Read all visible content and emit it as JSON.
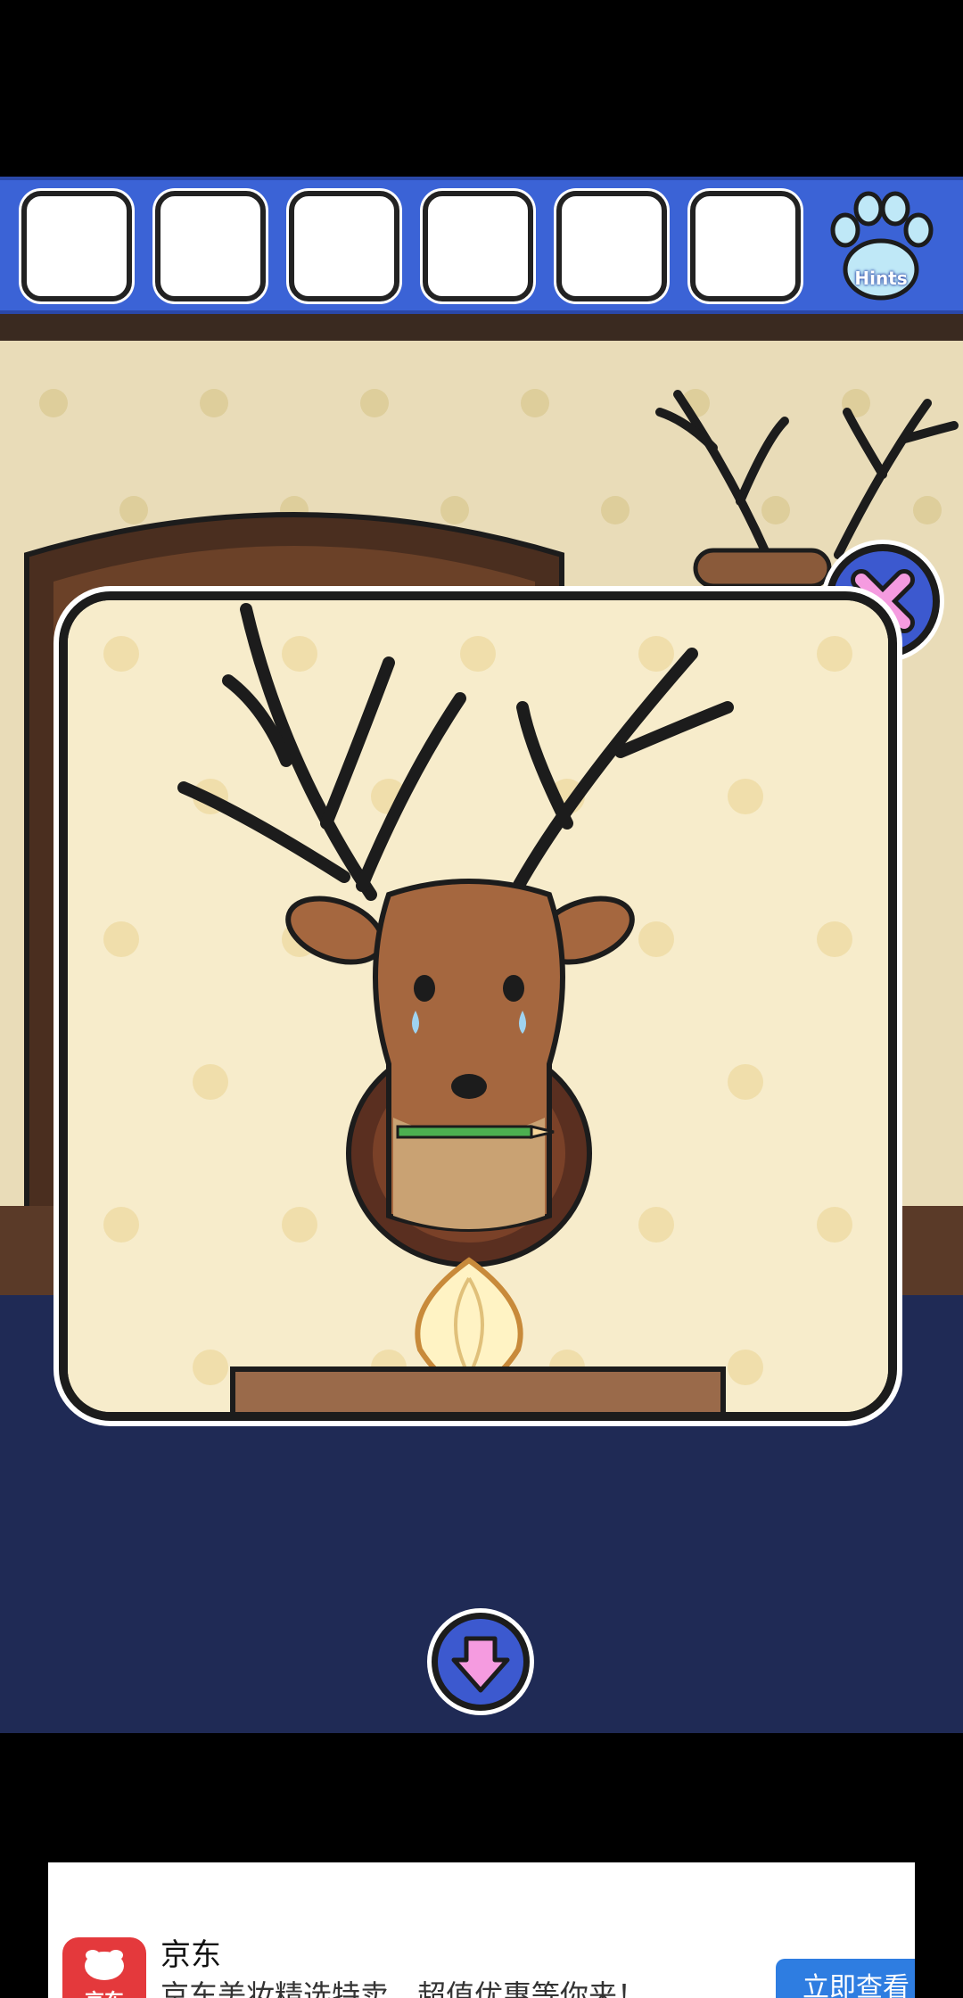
{
  "toolbar": {
    "slots": [
      "",
      "",
      "",
      "",
      "",
      ""
    ],
    "hints_label": "Hints",
    "hints_icon": "paw-icon"
  },
  "scene": {
    "wall_color": "#efe3c2",
    "floor_color": "#1f2a55",
    "modal_subject": "deer-head-trophy",
    "items": [
      "pencil-in-mouth",
      "onion-on-shelf"
    ]
  },
  "controls": {
    "close_icon": "close-x-icon",
    "back_icon": "down-arrow-icon"
  },
  "ad": {
    "brand": "京东",
    "logo_text": "京东",
    "description": "京东美妆精选特卖，超值优惠等你来！",
    "cta": "立即查看"
  }
}
